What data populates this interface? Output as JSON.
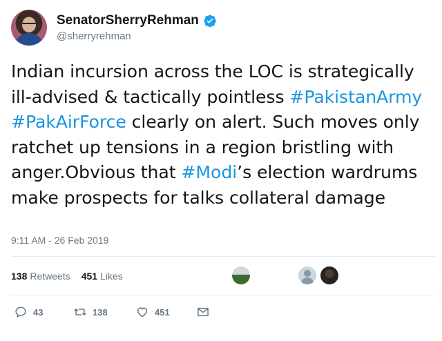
{
  "author": {
    "display_name": "SenatorSherryRehman",
    "handle": "@sherryrehman",
    "verified": true
  },
  "tweet": {
    "segments": [
      {
        "text": "Indian incursion across the LOC is strategically ill-advised & tactically pointless ",
        "type": "text"
      },
      {
        "text": "#PakistanArmy",
        "type": "hashtag"
      },
      {
        "text": " ",
        "type": "text"
      },
      {
        "text": "#PakAirForce",
        "type": "hashtag"
      },
      {
        "text": " clearly on alert. Such moves only ratchet up tensions in a region bristling with anger.Obvious that ",
        "type": "text"
      },
      {
        "text": "#Modi",
        "type": "hashtag"
      },
      {
        "text": "’s election wardrums make prospects for talks collateral damage",
        "type": "text"
      }
    ],
    "timestamp": "9:11 AM - 26 Feb 2019"
  },
  "stats": {
    "retweets_count": "138",
    "retweets_label": "Retweets",
    "likes_count": "451",
    "likes_label": "Likes"
  },
  "actions": {
    "reply_count": "43",
    "retweet_count": "138",
    "like_count": "451"
  },
  "colors": {
    "hashtag": "#1b95e0",
    "verified": "#1da1f2",
    "secondary_text": "#657786"
  }
}
